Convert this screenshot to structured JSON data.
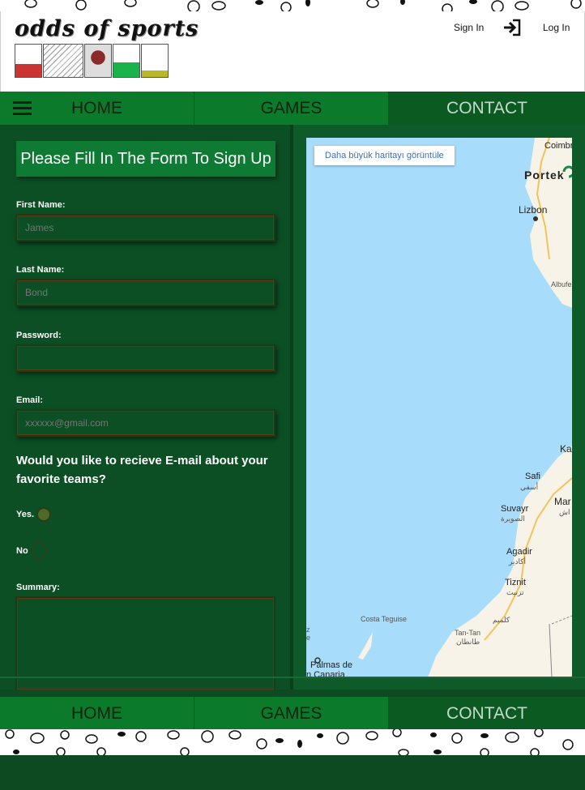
{
  "header": {
    "logo_text": "odds of sports",
    "signin_label": "Sign In",
    "login_label": "Log In"
  },
  "nav": {
    "items": [
      {
        "label": "HOME"
      },
      {
        "label": "GAMES"
      },
      {
        "label": "CONTACT"
      }
    ]
  },
  "form": {
    "heading": "Please Fill In The Form To Sign Up",
    "first_name_label": "First Name:",
    "first_name_placeholder": "James",
    "last_name_label": "Last Name:",
    "last_name_placeholder": "Bond",
    "password_label": "Password:",
    "email_label": "Email:",
    "email_placeholder": "xxxxxx@gmail.com",
    "question": "Would you like to recieve E-mail about your favorite teams?",
    "yes_label": "Yes.",
    "no_label": "No",
    "summary_label": "Summary:"
  },
  "map": {
    "larger_map_button": "Daha büyük haritayı görüntüle",
    "labels": {
      "coimbra": "Coimbr",
      "portugal": "Portek",
      "lisbon": "Lizbon",
      "albufeira": "Albufe",
      "kasablanka": "Ka",
      "safi": "Safi",
      "safi_ar": "أسفي",
      "marrakech": "Mar",
      "marrakech_ar": "اش",
      "essaouira": "Suvayr",
      "essaouira_ar": "الصويرة",
      "agadir": "Agadir",
      "agadir_ar": "أكادير",
      "tiznit": "Tiznit",
      "tiznit_ar": "تزنيت",
      "guelmim_ar": "كلميم",
      "costa_teguise": "Costa Teguise",
      "tan_tan": "Tan-Tan",
      "tan_tan_ar": "طانطان",
      "las_palmas": "Palmas de",
      "gran_canaria": "n Canaria",
      "edge_z": "z",
      "edge_e": "e"
    }
  },
  "colors": {
    "nav_green": "#0c7a2b",
    "nav_active": "#0a5a22",
    "form_bg": "#0c4f24",
    "map_water": "#a8dcfb"
  }
}
